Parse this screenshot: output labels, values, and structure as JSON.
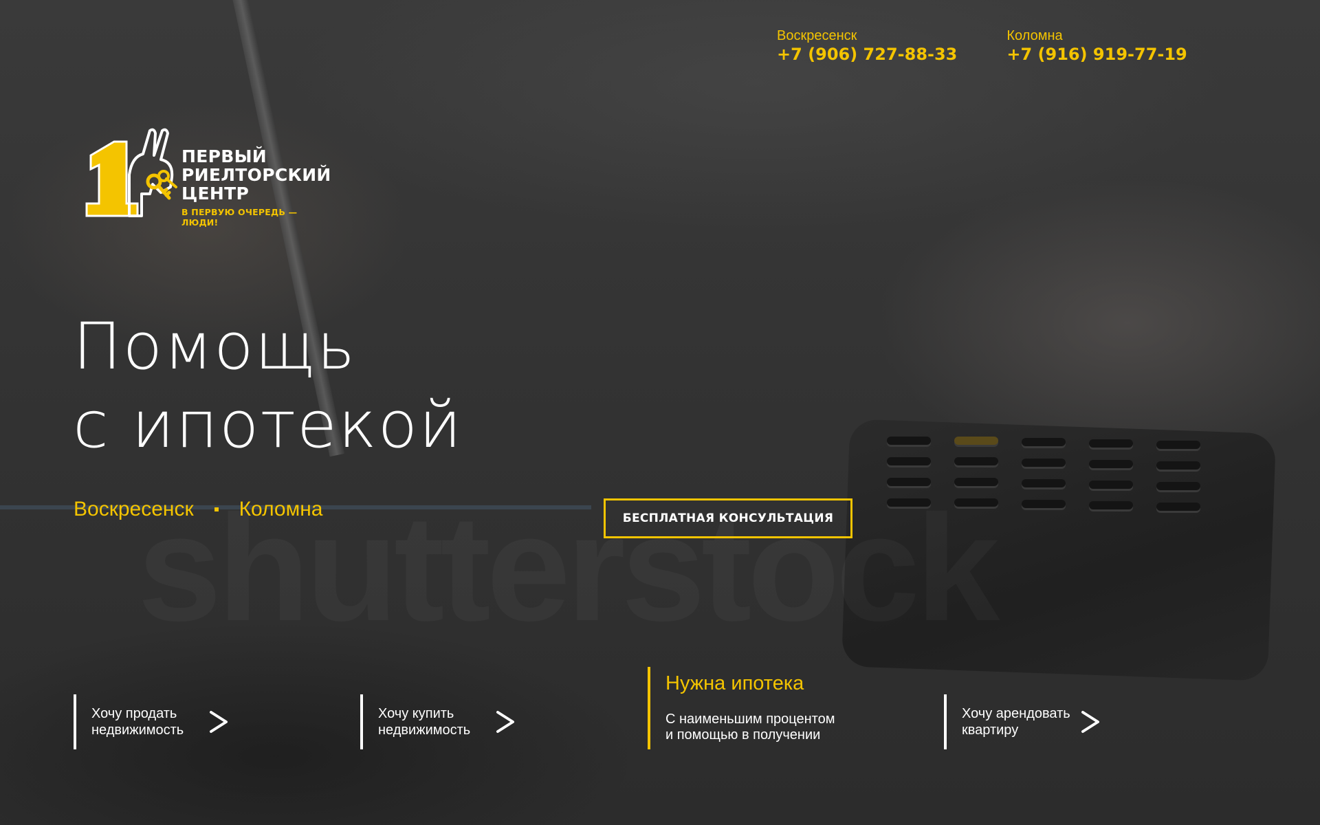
{
  "header": {
    "phones": [
      {
        "city": "Воскресенск",
        "number": "+7 (906) 727-88-33"
      },
      {
        "city": "Коломна",
        "number": "+7 (916) 919-77-19"
      }
    ]
  },
  "logo": {
    "lines": [
      "ПЕРВЫЙ",
      "РИЕЛТОРСКИЙ",
      "ЦЕНТР"
    ],
    "slogan": "В ПЕРВУЮ ОЧЕРЕДЬ — ЛЮДИ!",
    "digit": "1"
  },
  "hero": {
    "title_line1": "Помощь",
    "title_line2": "с ипотекой",
    "cities": [
      "Воскресенск",
      "Коломна"
    ],
    "cta_label": "БЕСПЛАТНАЯ КОНСУЛЬТАЦИЯ"
  },
  "background": {
    "watermark": "shutterstock"
  },
  "services": [
    {
      "line1": "Хочу продать",
      "line2": "недвижимость"
    },
    {
      "line1": "Хочу купить",
      "line2": "недвижимость"
    },
    {
      "line1": "Хочу арендовать",
      "line2": "квартиру"
    }
  ],
  "featured_service": {
    "title": "Нужна ипотека",
    "line1": "С наименьшим процентом",
    "line2": "и помощью в получении"
  },
  "colors": {
    "accent": "#f4c400",
    "text": "#ffffff",
    "background": "#333333"
  },
  "icons": {
    "arrow": "chevron-right-icon",
    "logo": "house-hand-keys-icon"
  }
}
